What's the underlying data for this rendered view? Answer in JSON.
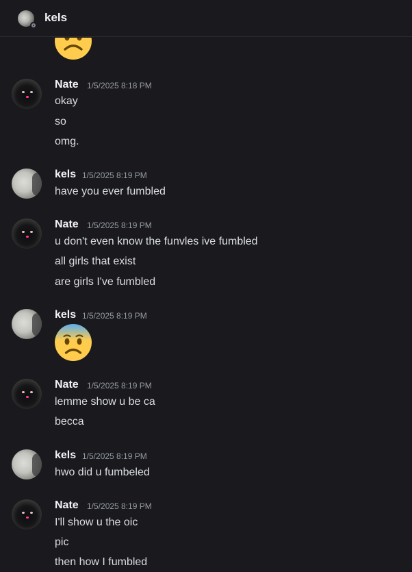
{
  "header": {
    "name": "kels",
    "avatar_icon": "white-cat-avatar",
    "status_icon": "offline-status-dot"
  },
  "messages": [
    {
      "author": "Nate",
      "timestamp": "1/5/2025 8:18 PM",
      "lines": [
        "okay",
        "so",
        "omg."
      ]
    },
    {
      "author": "kels",
      "timestamp": "1/5/2025 8:19 PM",
      "lines": [
        "have you ever fumbled"
      ]
    },
    {
      "author": "Nate",
      "timestamp": "1/5/2025 8:19 PM",
      "lines": [
        "u don't even know the funvles ive fumbled",
        "all girls that exist",
        "are girls I've fumbled"
      ]
    },
    {
      "author": "kels",
      "timestamp": "1/5/2025 8:19 PM",
      "emoji": "anxious-face-with-sweat-emoji"
    },
    {
      "author": "Nate",
      "timestamp": "1/5/2025 8:19 PM",
      "lines": [
        "lemme show u be ca",
        "becca"
      ]
    },
    {
      "author": "kels",
      "timestamp": "1/5/2025 8:19 PM",
      "lines": [
        "hwo did u fumbeled"
      ]
    },
    {
      "author": "Nate",
      "timestamp": "1/5/2025 8:19 PM",
      "lines": [
        "I'll show u the oic",
        "pic",
        "then how I fumbled"
      ]
    }
  ],
  "top_partial_emoji": "frowning-face-emoji",
  "colors": {
    "background": "#1a1a1e",
    "text": "#dbdee1",
    "username": "#f2f3f5",
    "timestamp": "#949ba4",
    "emoji_face": "#ffcc4d"
  }
}
